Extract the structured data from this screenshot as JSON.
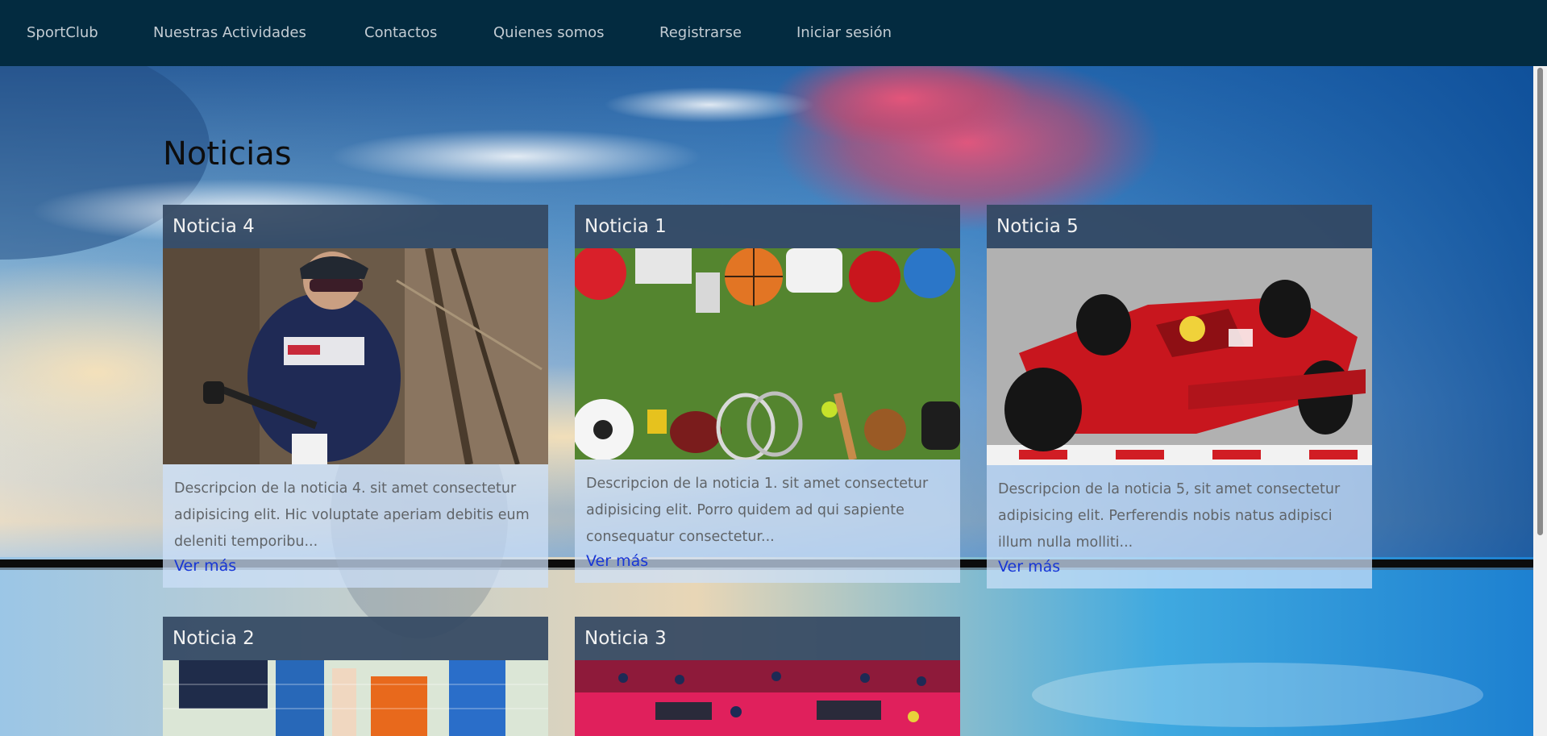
{
  "nav": {
    "brand": "SportClub",
    "items": [
      "Nuestras Actividades",
      "Contactos",
      "Quienes somos",
      "Registrarse",
      "Iniciar sesión"
    ]
  },
  "page": {
    "title": "Noticias"
  },
  "cards": [
    {
      "title": "Noticia 4",
      "image": "mountain-bike-rider-photo",
      "description": "Descripcion de la noticia 4. sit amet consectetur adipisicing elit. Hic voluptate aperiam debitis eum deleniti temporibu...",
      "link": "Ver más"
    },
    {
      "title": "Noticia 1",
      "image": "sports-equipment-on-grass-photo",
      "description": "Descripcion de la noticia 1. sit amet consectetur adipisicing elit. Porro quidem ad qui sapiente consequatur consectetur...",
      "link": "Ver más"
    },
    {
      "title": "Noticia 5",
      "image": "red-formula-one-car-photo",
      "description": "Descripcion de la noticia 5, sit amet consectetur adipisicing elit. Perferendis nobis natus adipisci illum nulla molliti...",
      "link": "Ver más"
    },
    {
      "title": "Noticia 2",
      "image": "kids-soccer-photo"
    },
    {
      "title": "Noticia 3",
      "image": "table-tennis-arena-photo"
    }
  ],
  "colors": {
    "navbar": "#032b40",
    "nav_text": "#c3ccd3",
    "card_header": "#344862",
    "link": "#1736d6"
  }
}
